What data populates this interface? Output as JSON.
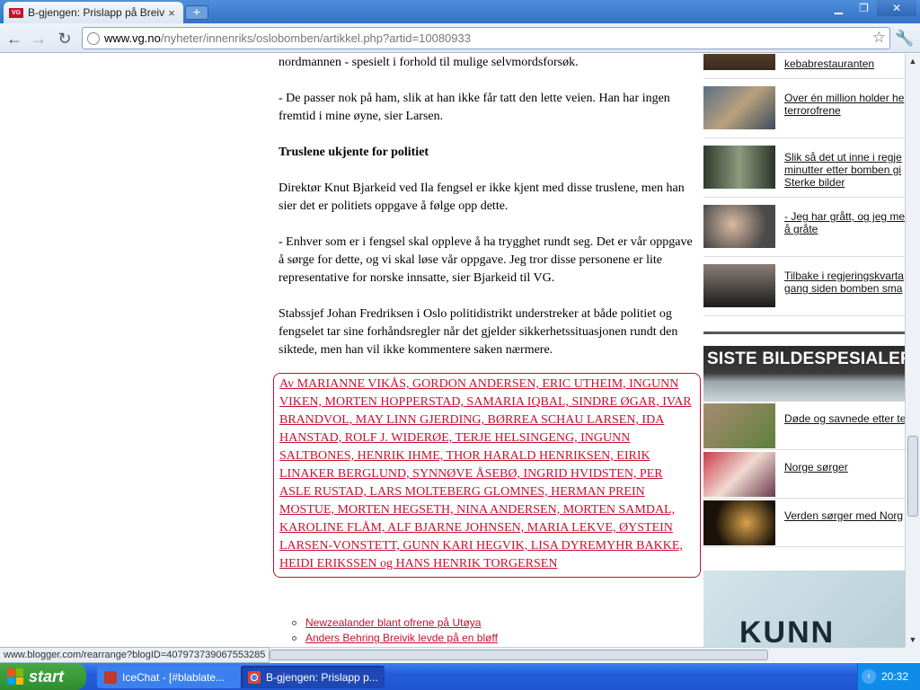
{
  "browser": {
    "tab_title": "B-gjengen: Prislapp på Breivik",
    "tab_favicon": "VG",
    "new_tab_label": "+",
    "url_host": "www.vg.no",
    "url_rest": "/nyheter/innenriks/oslobomben/artikkel.php?artid=10080933",
    "status_text": "www.blogger.com/rearrange?blogID=407973739067553285"
  },
  "article": {
    "para_top": "nordmannen - spesielt i forhold til mulige selvmordsforsøk.",
    "para1": "- De passer nok på ham, slik at han ikke får tatt den lette veien. Han har ingen fremtid i mine øyne, sier Larsen.",
    "heading": "Truslene ukjente for politiet",
    "para2": "Direktør Knut Bjarkeid ved Ila fengsel er ikke kjent med disse truslene, men han sier det er politiets oppgave å følge opp dette.",
    "para3": "- Enhver som er i fengsel skal oppleve å ha trygghet rundt seg. Det er vår oppgave å sørge for dette, og vi skal løse vår oppgave. Jeg tror disse personene er lite representative for norske innsatte, sier Bjarkeid til VG.",
    "para4": "Stabssjef Johan Fredriksen i Oslo politidistrikt understreker at både politiet og fengselet tar sine forhåndsregler når det gjelder sikkerhetssituasjonen rundt den siktede, men han vil ikke kommentere saken nærmere.",
    "byline": "Av MARIANNE VIKÅS, GORDON ANDERSEN, ERIC UTHEIM, INGUNN VIKEN, MORTEN HOPPERSTAD, SAMARIA IQBAL, SINDRE ØGAR, IVAR BRANDVOL, MAY LINN GJERDING, BØRREA SCHAU LARSEN, IDA HANSTAD, ROLF J. WIDERØE, TERJE HELSINGENG, INGUNN SALTBONES, HENRIK IHME, THOR HARALD HENRIKSEN, EIRIK LINAKER BERGLUND, SYNNØVE ÅSEBØ, INGRID HVIDSTEN, PER ASLE RUSTAD, LARS MOLTEBERG GLOMNES, HERMAN PREIN MOSTUE, MORTEN HEGSETH, NINA ANDERSEN, MORTEN SAMDAL, KAROLINE FLÅM, ALF BJARNE JOHNSEN, MARIA LEKVE, ØYSTEIN LARSEN-VONSTETT, GUNN KARI HEGVIK, LISA DYREMYHR BAKKE, HEIDI ERIKSSEN og HANS HENRIK TORGERSEN",
    "related": [
      "Newzealander blant ofrene på Utøya",
      "Anders Behring Breivik levde på en bløff"
    ]
  },
  "sidebar": {
    "items": [
      {
        "text": "kebabrestauranten"
      },
      {
        "text": "Over én million holder he terrorofrene"
      },
      {
        "text": "Slik så det ut inne i regje minutter etter bomben gi Sterke bilder"
      },
      {
        "text": "- Jeg har grått, og jeg me å gråte"
      },
      {
        "text": "Tilbake i regjeringskvarta gang siden bomben sma"
      }
    ],
    "banner_title": "SISTE BILDESPESIALER",
    "items2": [
      {
        "text": "Døde og savnede etter te"
      },
      {
        "text": "Norge sørger"
      },
      {
        "text": "Verden sørger med Norg"
      }
    ],
    "ad_text": "KUNN"
  },
  "taskbar": {
    "start_label": "start",
    "tasks": [
      "IceChat - [#blablate...",
      "B-gjengen: Prislapp p..."
    ],
    "clock": "20:32"
  }
}
